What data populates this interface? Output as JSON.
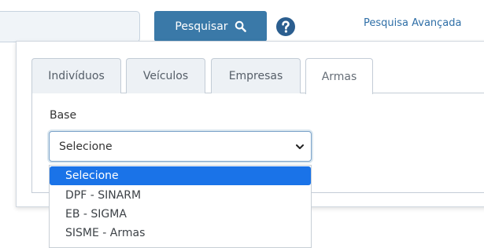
{
  "search": {
    "input_value": "",
    "button_label": "Pesquisar",
    "icon": "search-icon",
    "help_icon": "question-circle-icon",
    "advanced_link": "Pesquisa Avançada"
  },
  "tabs": [
    {
      "label": "Indivíduos",
      "active": false
    },
    {
      "label": "Veículos",
      "active": false
    },
    {
      "label": "Empresas",
      "active": false
    },
    {
      "label": "Armas",
      "active": true
    }
  ],
  "form": {
    "base_label": "Base",
    "select_value": "Selecione",
    "options": [
      {
        "label": "Selecione",
        "selected": true
      },
      {
        "label": "DPF - SINARM",
        "selected": false
      },
      {
        "label": "EB - SIGMA",
        "selected": false
      },
      {
        "label": "SISME - Armas",
        "selected": false
      }
    ]
  },
  "colors": {
    "primary_button": "#3a79a8",
    "link": "#2f6fa7",
    "selected_option": "#1a73e8",
    "help_icon": "#2b5e8f"
  }
}
